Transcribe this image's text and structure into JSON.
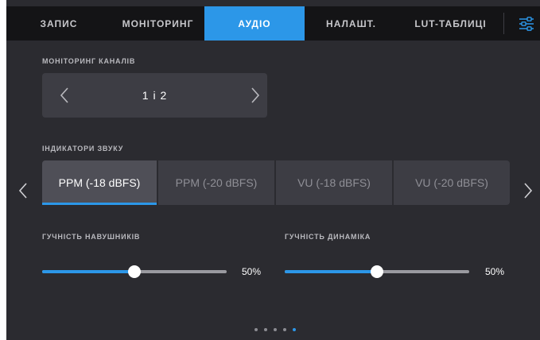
{
  "tabs": [
    {
      "label": "ЗАПИС",
      "active": false
    },
    {
      "label": "МОНІТОРИНГ",
      "active": false
    },
    {
      "label": "АУДІО",
      "active": true
    },
    {
      "label": "НАЛАШТ.",
      "active": false
    },
    {
      "label": "LUT-ТАБЛИЦІ",
      "active": false
    }
  ],
  "settings_icon": "sliders-icon",
  "channel_monitoring": {
    "label": "МОНІТОРИНГ КАНАЛІВ",
    "value": "1 і 2",
    "prev_icon": "chevron-left-icon",
    "next_icon": "chevron-right-icon"
  },
  "audio_meters": {
    "label": "ІНДИКАТОРИ ЗВУКУ",
    "options": [
      {
        "label": "PPM (-18 dBFS)",
        "selected": true
      },
      {
        "label": "PPM (-20 dBFS)",
        "selected": false
      },
      {
        "label": "VU (-18 dBFS)",
        "selected": false
      },
      {
        "label": "VU (-20 dBFS)",
        "selected": false
      }
    ]
  },
  "headphone_volume": {
    "label": "ГУЧНІСТЬ НАВУШНИКІВ",
    "value": 50,
    "value_text": "50%"
  },
  "speaker_volume": {
    "label": "ГУЧНІСТЬ ДИНАМІКА",
    "value": 50,
    "value_text": "50%"
  },
  "pagination": {
    "total": 5,
    "active_index": 4
  },
  "colors": {
    "accent": "#2c97e8",
    "background": "#2b2b30",
    "tabbar": "#141416"
  }
}
